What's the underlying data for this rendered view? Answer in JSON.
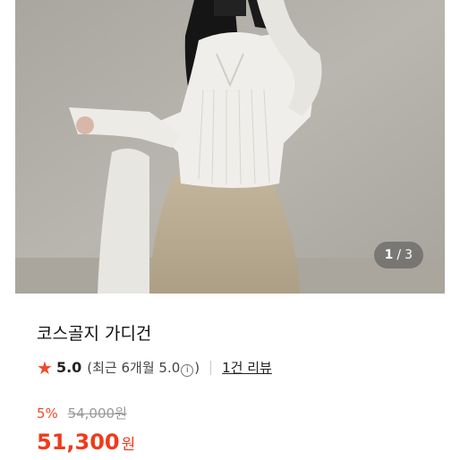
{
  "product": {
    "title": "코스골지 가디건",
    "image_pager": {
      "current": "1",
      "separator": "/",
      "total": "3"
    },
    "rating": {
      "icon": "star-icon",
      "score": "5.0",
      "recent_prefix": "(최근 6개월 5.0",
      "recent_suffix": ")",
      "info_glyph": "i",
      "reviews_link": "1건 리뷰"
    },
    "price": {
      "discount": "5%",
      "original": "54,000원",
      "final": "51,300",
      "currency": "원"
    }
  },
  "colors": {
    "accent": "#f04a2a",
    "price": "#ef3b1a"
  }
}
